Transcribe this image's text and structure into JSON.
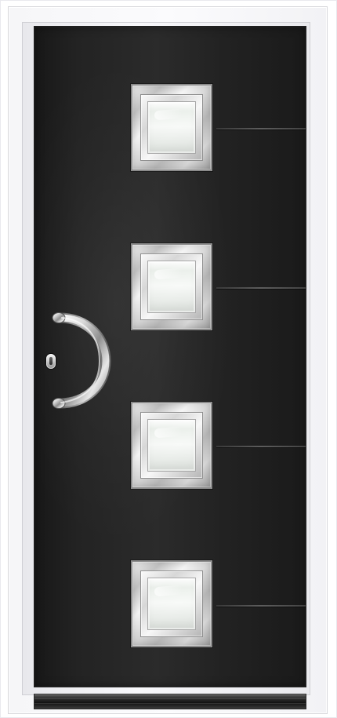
{
  "scene": {
    "subject": "front-door",
    "colors": {
      "frame": "#f6f6f8",
      "door_panel": "#232323",
      "glass": "#f3f5f3",
      "metal": "#c6c6c6",
      "groove": "#4d4d4d"
    },
    "window_count": 4,
    "groove_count": 4,
    "handle": "curved-steel-bar",
    "lock": "cylinder-lock",
    "threshold": "aluminum-sill"
  }
}
